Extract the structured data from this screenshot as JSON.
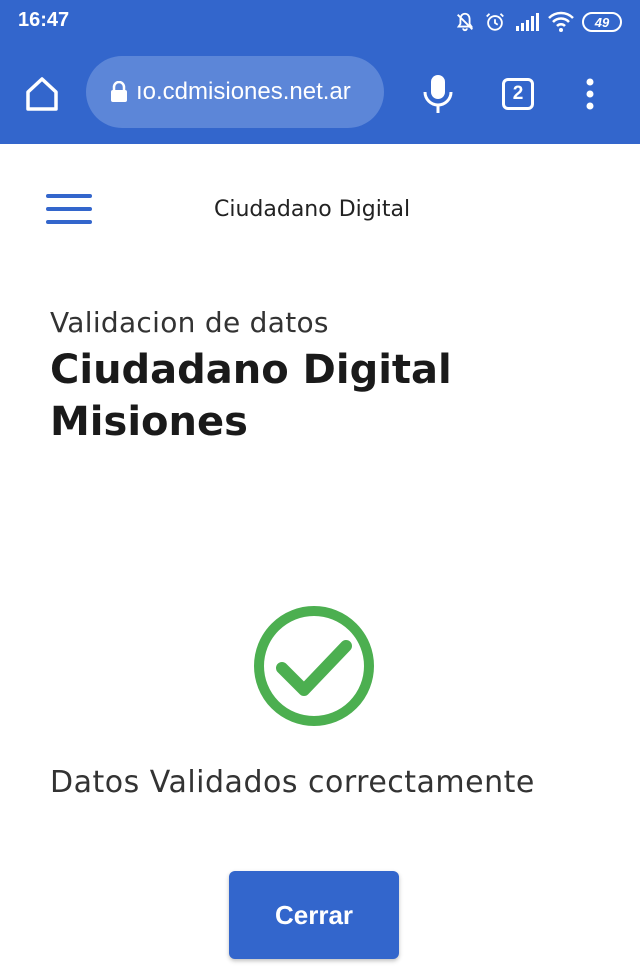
{
  "status_bar": {
    "time": "16:47",
    "battery": "49",
    "icons": [
      "mute-icon",
      "alarm-icon",
      "signal-icon",
      "wifi-icon",
      "battery-icon"
    ]
  },
  "browser": {
    "url": "ıo.cdmisiones.net.ar",
    "tab_count": "2",
    "toolbar_color": "#3366cc"
  },
  "header": {
    "site_title": "Ciudadano Digital"
  },
  "main": {
    "subtitle": "Validacion de datos",
    "headline": "Ciudadano Digital Misiones",
    "status_message": "Datos Validados correctamente",
    "success_color": "#4caf50",
    "close_label": "Cerrar"
  }
}
